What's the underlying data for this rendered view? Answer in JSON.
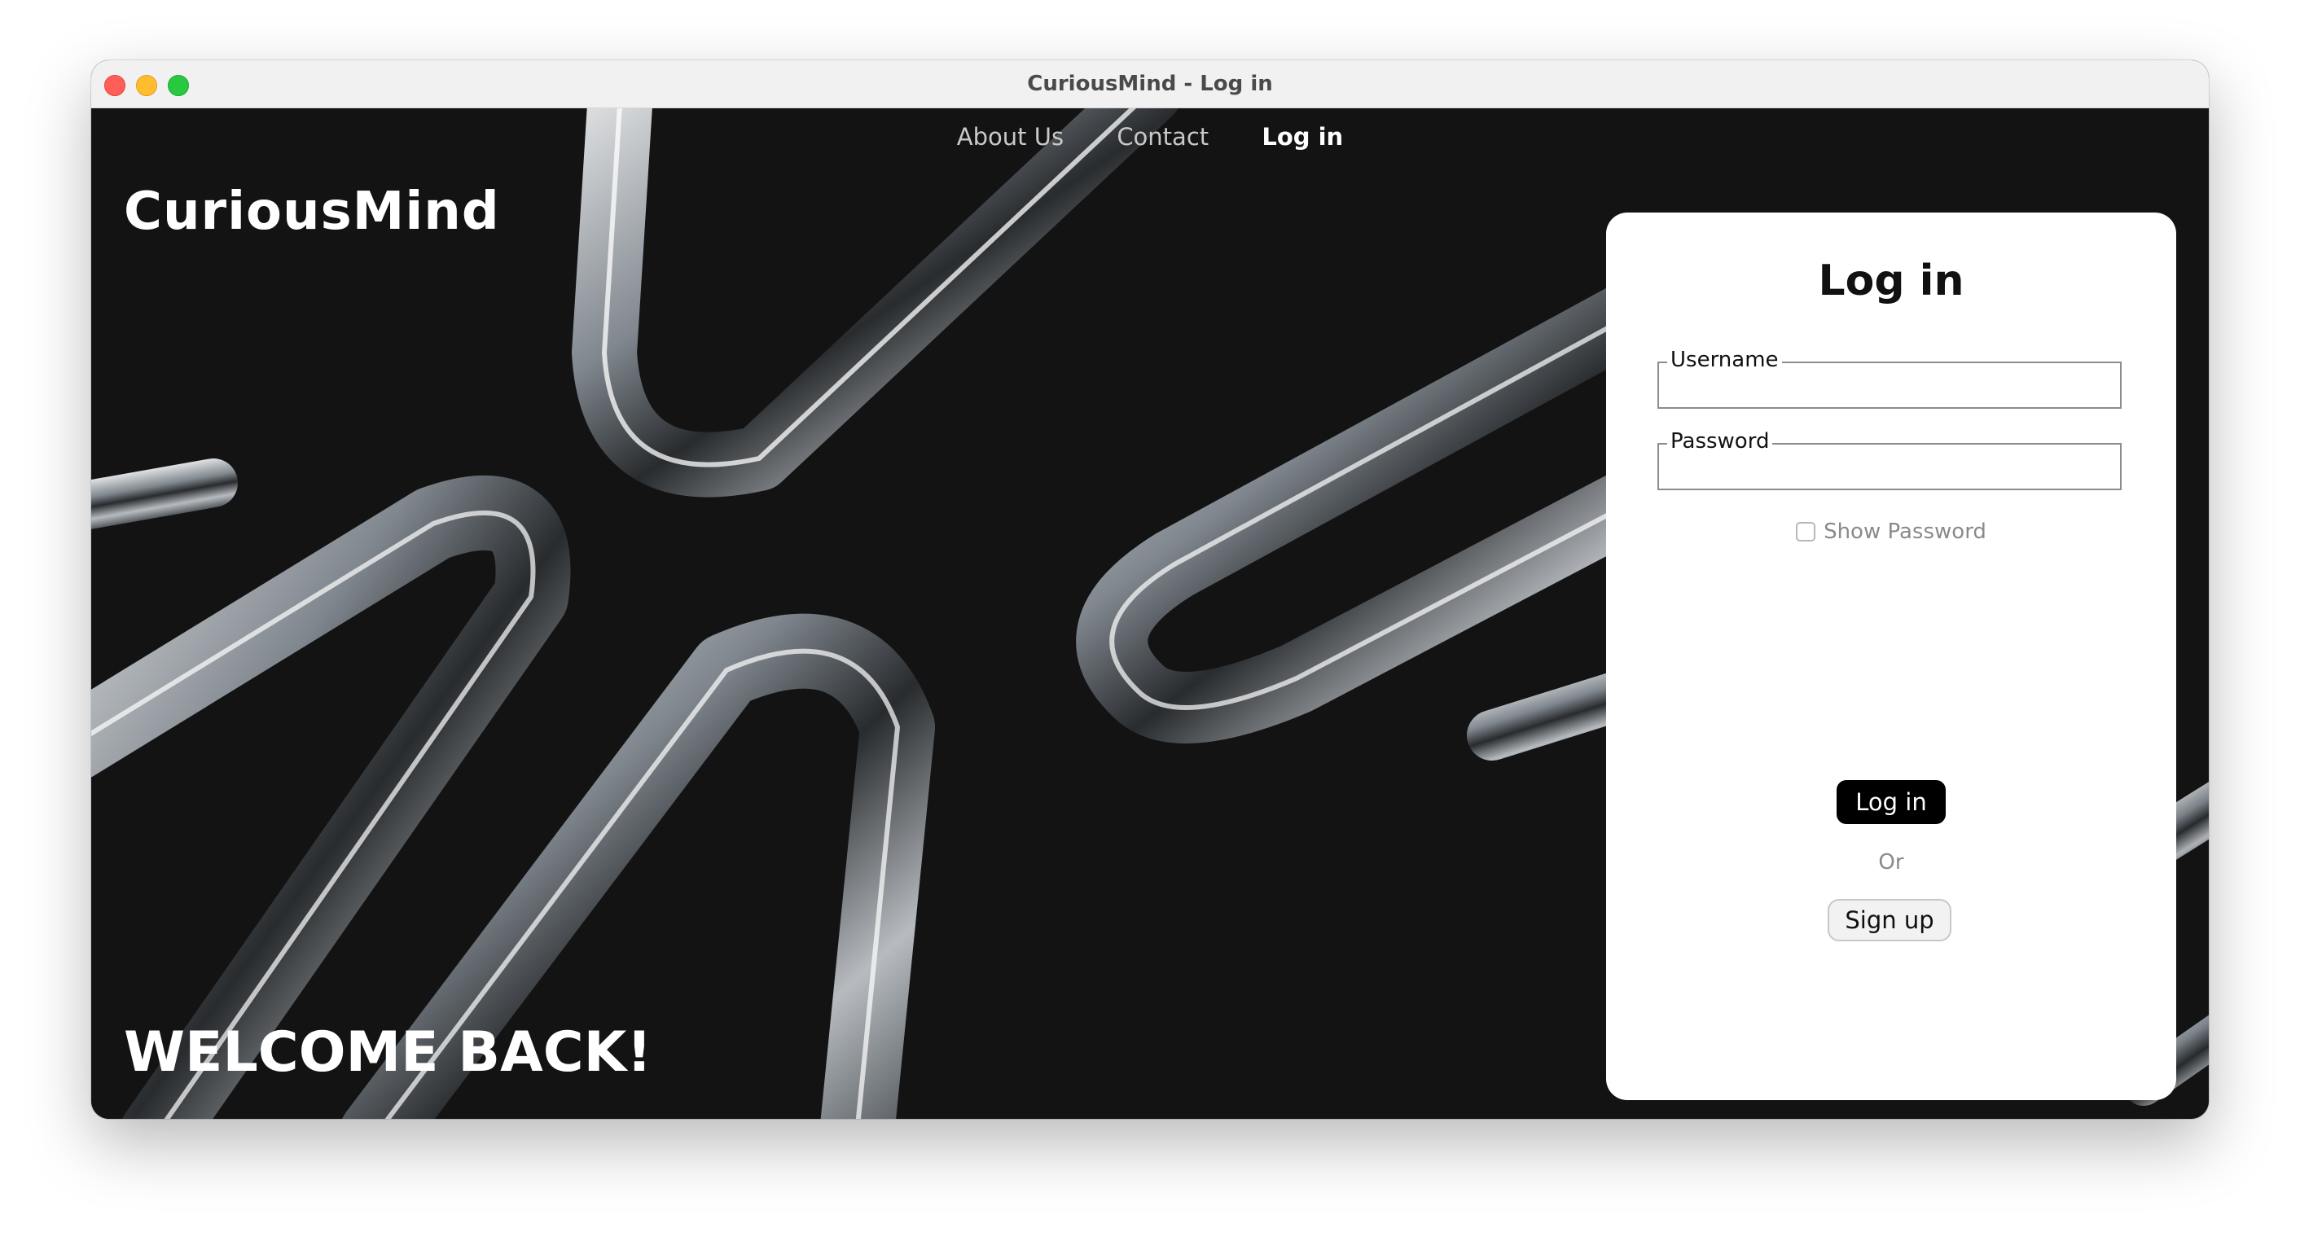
{
  "window": {
    "title": "CuriousMind - Log in"
  },
  "nav": {
    "items": [
      {
        "label": "About Us",
        "active": false
      },
      {
        "label": "Contact",
        "active": false
      },
      {
        "label": "Log in",
        "active": true
      }
    ]
  },
  "hero": {
    "brand": "CuriousMind",
    "welcome": "WELCOME BACK!"
  },
  "login_form": {
    "title": "Log in",
    "username_label": "Username",
    "username_value": "",
    "password_label": "Password",
    "password_value": "",
    "show_password_label": "Show Password",
    "show_password_checked": false,
    "login_button": "Log in",
    "or_text": "Or",
    "signup_button": "Sign up"
  },
  "colors": {
    "background": "#131313",
    "card": "#ffffff",
    "primary_button": "#000000",
    "close": "#ff5f57",
    "minimize": "#febc2e",
    "maximize": "#28c840"
  }
}
